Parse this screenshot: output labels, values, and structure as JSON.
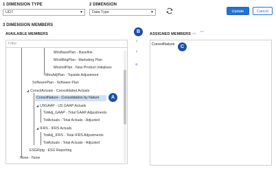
{
  "dimension_type": {
    "label": "1 DIMENSION TYPE",
    "value": "UD7"
  },
  "dimension": {
    "label": "2 DIMENSION",
    "value": "Data Type"
  },
  "buttons": {
    "update": "Update",
    "cancel": "Cancel"
  },
  "members_section": {
    "label": "3 DIMENSION MEMBERS"
  },
  "available": {
    "label": "AVAILABLE MEMBERS",
    "filter_placeholder": "Filter",
    "nodes": [
      {
        "text": "MtrsBasePlan - Baseline"
      },
      {
        "text": "MtrsMktgPlan - Marketing Plan"
      },
      {
        "text": "MtrsInitPlan - New Product Initiatives"
      },
      {
        "text": "MtrsAdjPlan - Topside Adjustment"
      },
      {
        "text": "SoftwarePlan - Software Plan"
      },
      {
        "text": "ConsolActuals - Consolidated Actuals"
      },
      {
        "text": "ConsolNature - Consolidation by Nature"
      },
      {
        "text": "USGAAP - US GAAP Actuals"
      },
      {
        "text": "TotAdj_GAAP - Total GAAP Adjustments"
      },
      {
        "text": "TotActuals - Total Actuals - Adjusted"
      },
      {
        "text": "IFRS - IFRS Actuals"
      },
      {
        "text": "TotAdj_IFRS - Total IFRS Adjustments"
      },
      {
        "text": "TotActuals - Total Actuals - Adjusted"
      },
      {
        "text": "ESGRptg - ESG Reporting"
      },
      {
        "text": "None - None"
      }
    ]
  },
  "assigned": {
    "label": "ASSIGNED MEMBERS",
    "items": [
      "ConsolNature"
    ]
  },
  "badges": {
    "a": "A",
    "b": "B",
    "c": "C"
  },
  "colors": {
    "accent": "#1f74d4",
    "badge": "#1f4fa6",
    "selected_row": "#cfe1f7"
  }
}
